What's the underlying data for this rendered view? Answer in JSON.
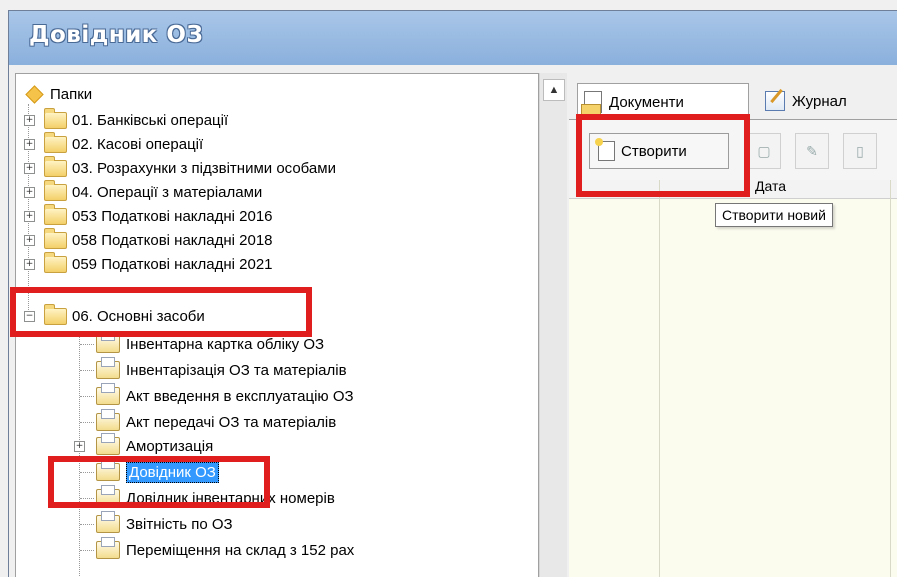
{
  "window": {
    "title": "Довідник ОЗ"
  },
  "tree": {
    "root_label": "Папки",
    "folders": [
      {
        "label": "01. Банківські операції"
      },
      {
        "label": "02. Касові операції"
      },
      {
        "label": "03. Розрахунки з підзвітними особами"
      },
      {
        "label": "04. Операції з матеріалами"
      },
      {
        "label": "053 Податкові накладні 2016"
      },
      {
        "label": "058 Податкові накладні 2018"
      },
      {
        "label": "059 Податкові накладні 2021"
      },
      {
        "label": "06. Основні засоби"
      }
    ],
    "children": [
      {
        "label": "Інвентарна картка обліку ОЗ"
      },
      {
        "label": "Інвентарізація ОЗ та матеріалів"
      },
      {
        "label": "Акт введення в експлуатацію ОЗ"
      },
      {
        "label": "Акт передачі ОЗ та матеріалів"
      },
      {
        "label": "Амортизація"
      },
      {
        "label": "Довідник ОЗ"
      },
      {
        "label": "Довідник інвентарних номерів"
      },
      {
        "label": "Звітність по ОЗ"
      },
      {
        "label": "Переміщення на склад з 152 рах"
      }
    ],
    "selected": "Довідник ОЗ"
  },
  "tabs": [
    {
      "label": "Документи",
      "active": true
    },
    {
      "label": "Журнал",
      "active": false
    }
  ],
  "toolbar": {
    "create_label": "Створити"
  },
  "grid": {
    "date_header": "Дата"
  },
  "tooltip": {
    "text": "Створити новий"
  },
  "colors": {
    "highlight": "#e01e1e",
    "selection": "#3399ff",
    "titlebar": "#94b6de"
  }
}
